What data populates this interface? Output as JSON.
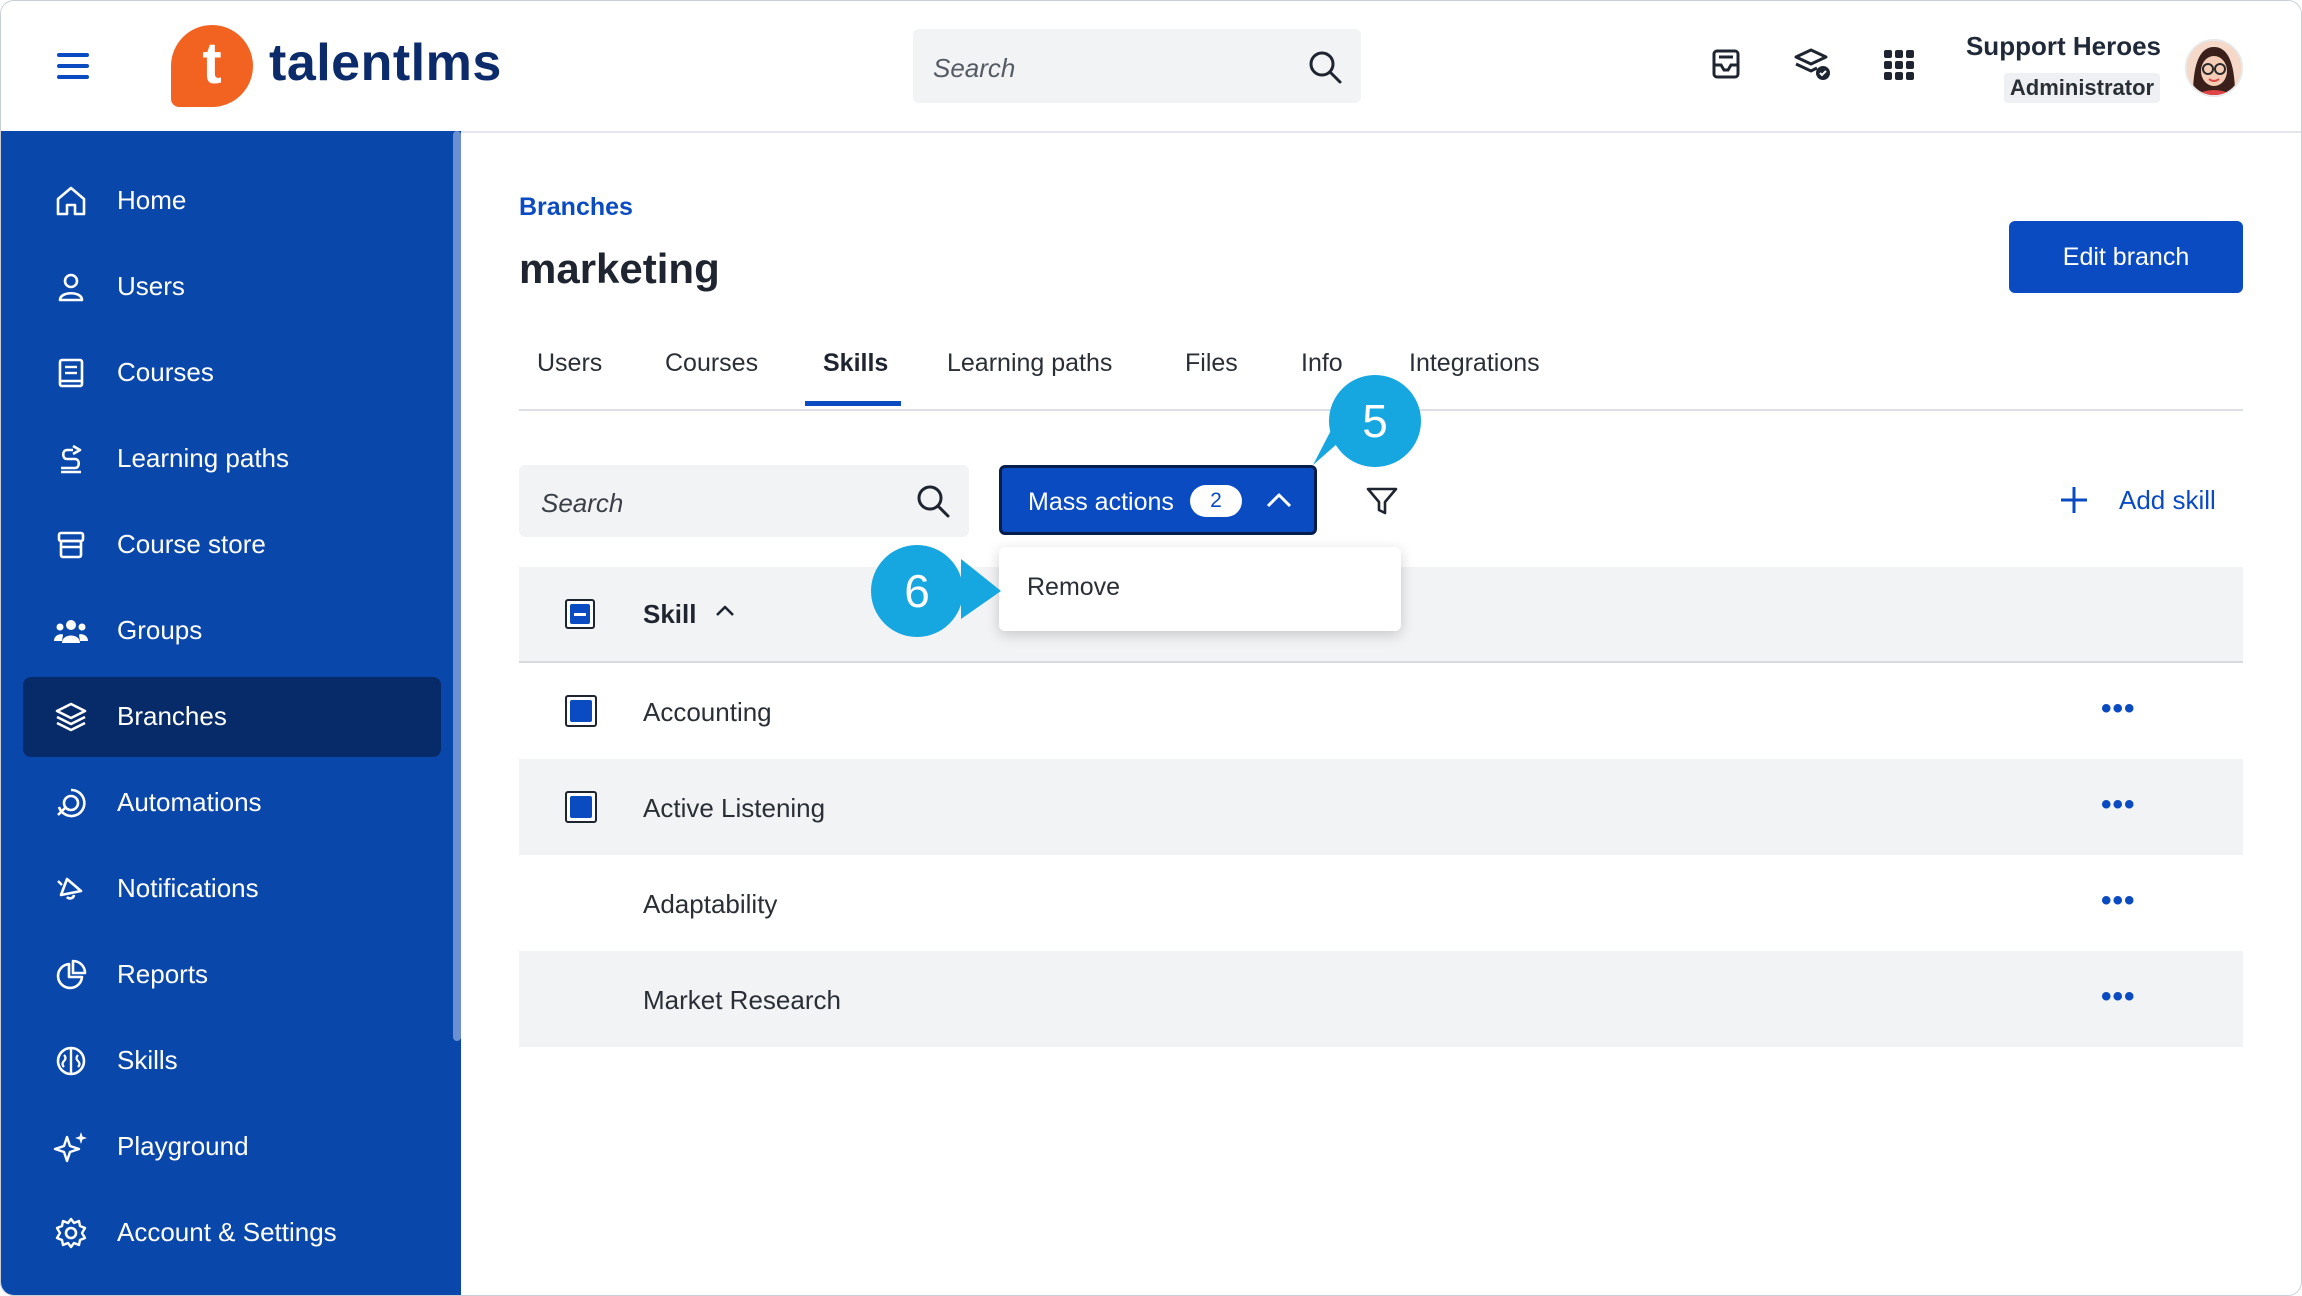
{
  "header": {
    "logo_text": "talentlms",
    "logo_mark": "t",
    "search_placeholder": "Search",
    "user_name": "Support Heroes",
    "user_role": "Administrator",
    "icons": [
      "hamburger-icon",
      "mail-icon",
      "stack-icon",
      "apps-grid-icon"
    ]
  },
  "sidebar": {
    "items": [
      {
        "label": "Home",
        "icon": "home-icon"
      },
      {
        "label": "Users",
        "icon": "user-icon"
      },
      {
        "label": "Courses",
        "icon": "book-icon"
      },
      {
        "label": "Learning paths",
        "icon": "path-icon"
      },
      {
        "label": "Course store",
        "icon": "store-icon"
      },
      {
        "label": "Groups",
        "icon": "groups-icon"
      },
      {
        "label": "Branches",
        "icon": "layers-icon",
        "active": true
      },
      {
        "label": "Automations",
        "icon": "automation-icon"
      },
      {
        "label": "Notifications",
        "icon": "bell-icon"
      },
      {
        "label": "Reports",
        "icon": "pie-icon"
      },
      {
        "label": "Skills",
        "icon": "brain-icon"
      },
      {
        "label": "Playground",
        "icon": "sparkle-icon"
      },
      {
        "label": "Account & Settings",
        "icon": "gear-icon"
      }
    ]
  },
  "main": {
    "breadcrumb": "Branches",
    "title": "marketing",
    "edit_button": "Edit branch",
    "tabs": [
      "Users",
      "Courses",
      "Skills",
      "Learning paths",
      "Files",
      "Info",
      "Integrations"
    ],
    "active_tab": "Skills",
    "search_placeholder": "Search",
    "mass_actions": {
      "label": "Mass actions",
      "count": "2"
    },
    "dropdown": {
      "items": [
        "Remove"
      ]
    },
    "add_skill": "Add skill",
    "table": {
      "column": "Skill",
      "rows": [
        {
          "label": "Accounting",
          "checked": true
        },
        {
          "label": "Active Listening",
          "checked": true
        },
        {
          "label": "Adaptability",
          "checked": false
        },
        {
          "label": "Market Research",
          "checked": false
        }
      ]
    },
    "callouts": [
      "5",
      "6"
    ]
  },
  "colors": {
    "primary": "#0a4bc2",
    "sidebar": "#0a47aa",
    "sidebar_active": "#072a68",
    "brand_orange": "#f26322",
    "callout": "#16a6e0"
  }
}
